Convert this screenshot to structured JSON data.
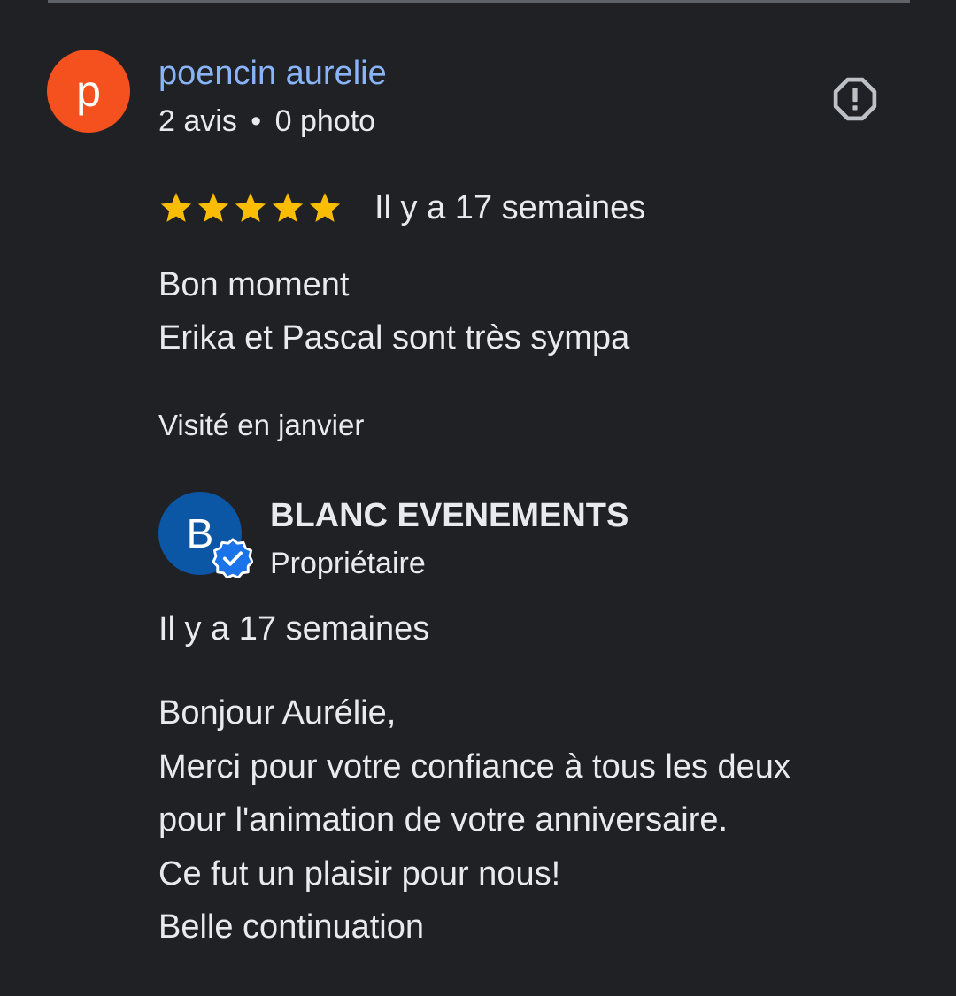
{
  "review": {
    "avatar_letter": "p",
    "avatar_color": "#f4511e",
    "author": "poencin aurelie",
    "reviews_count": "2 avis",
    "separator": "•",
    "photos_count": "0 photo",
    "rating": 5,
    "rating_max": 5,
    "star_color": "#fbbc04",
    "date": "Il y a 17 semaines",
    "text_lines": [
      "Bon moment",
      "Erika et Pascal sont très sympa"
    ],
    "visited": "Visité en janvier",
    "report_icon": "report-flag-icon"
  },
  "reply": {
    "avatar_letter": "B",
    "avatar_color": "#0b57a6",
    "badge_icon": "verified-check-icon",
    "owner_name": "BLANC EVENEMENTS",
    "owner_role": "Propriétaire",
    "date": "Il y a 17 semaines",
    "text_lines": [
      "Bonjour Aurélie,",
      "Merci pour votre confiance à tous les deux",
      "pour l'animation de votre anniversaire.",
      "Ce fut un plaisir pour nous!",
      "Belle continuation"
    ]
  },
  "colors": {
    "background": "#202124",
    "link": "#8ab4f8",
    "text": "#e8eaed"
  }
}
